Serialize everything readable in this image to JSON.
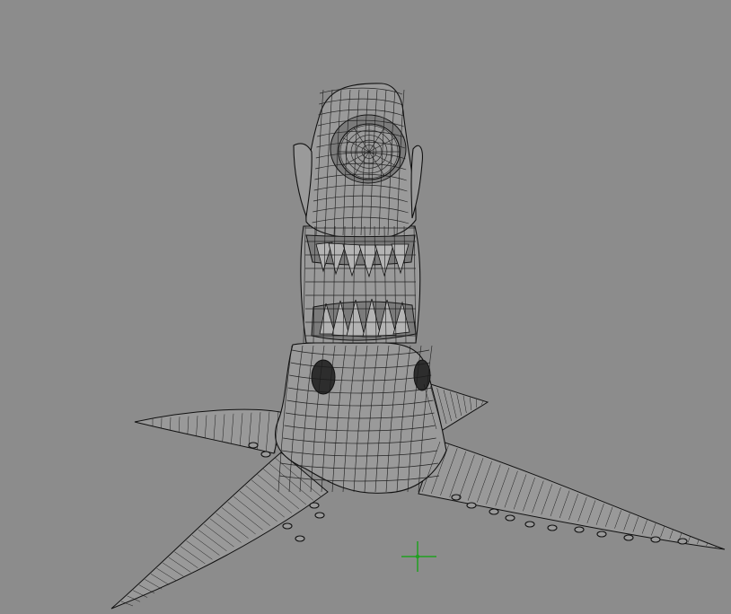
{
  "viewport": {
    "background_color": "#8c8c8c",
    "mesh_color": "#9a9a9a",
    "wire_color": "#1a1a1a",
    "pivot_color": "#20a020"
  },
  "scene": {
    "objects": [
      {
        "name": "wireframe-creature-mesh",
        "icon": "polygon-mesh-icon"
      },
      {
        "name": "pivot-manipulator",
        "icon": "crosshair-icon"
      }
    ]
  }
}
